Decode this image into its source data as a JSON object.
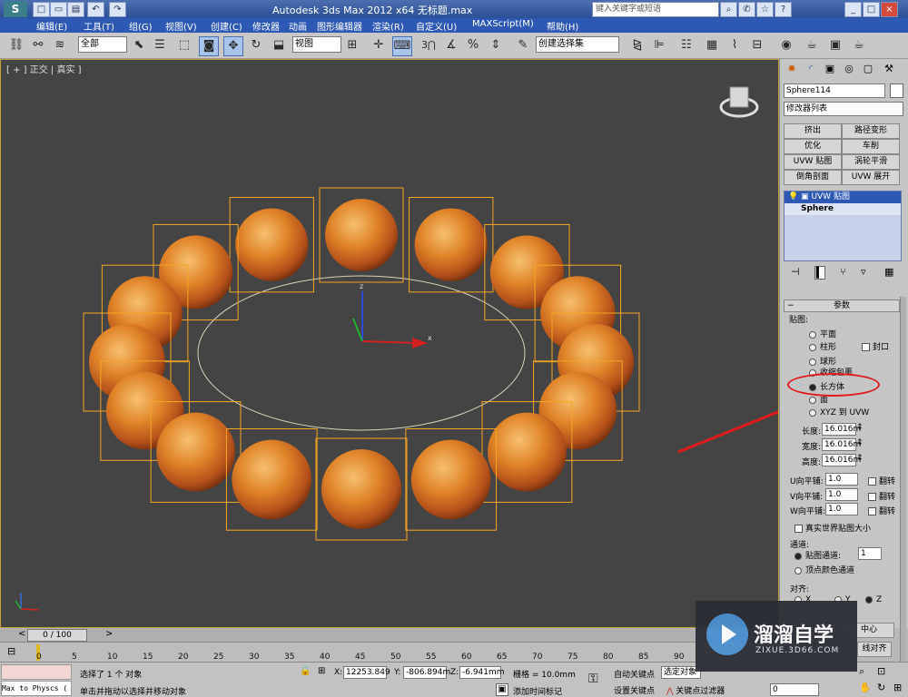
{
  "title_bar": {
    "title": "Autodesk 3ds Max  2012 x64    无标题.max",
    "search_placeholder": "键入关键字或短语"
  },
  "menu": {
    "items": [
      "编辑(E)",
      "工具(T)",
      "组(G)",
      "视图(V)",
      "创建(C)",
      "修改器",
      "动画",
      "图形编辑器",
      "渲染(R)",
      "自定义(U)",
      "MAXScript(M)",
      "帮助(H)"
    ]
  },
  "toolbar": {
    "selection_filter": "全部",
    "reference_coord": "视图",
    "named_selection": "创建选择集",
    "snap_label": "3"
  },
  "viewport": {
    "label": "[ + ] 正交 | 真实 ]",
    "axis_x": "x",
    "axis_y": "y",
    "axis_z": "z"
  },
  "command_panel": {
    "object_name": "Sphere114",
    "modifier_list": "修改器列表",
    "buttons": [
      "挤出",
      "路径变形",
      "优化",
      "车削",
      "UVW 贴图",
      "涡轮平滑",
      "倒角剖面",
      "UVW 展开"
    ],
    "stack_item": "UVW 贴图",
    "stack_base": "Sphere",
    "rollout_title": "参数",
    "mapping_group": "贴图:",
    "mapping_options": [
      "平面",
      "柱形",
      "球形",
      "收缩包裹",
      "长方体",
      "面",
      "XYZ 到 UVW"
    ],
    "cap_label": "封口",
    "selected_mapping": "长方体",
    "length_label": "长度:",
    "length_value": "16.016m",
    "width_label": "宽度:",
    "width_value": "16.016m",
    "height_label": "高度:",
    "height_value": "16.016m",
    "u_tile_label": "U向平铺:",
    "u_tile_value": "1.0",
    "v_tile_label": "V向平铺:",
    "v_tile_value": "1.0",
    "w_tile_label": "W向平铺:",
    "w_tile_value": "1.0",
    "flip_label": "翻转",
    "real_world_label": "真实世界贴图大小",
    "channel_group": "通道:",
    "map_channel_label": "贴图通道:",
    "map_channel_value": "1",
    "vertex_color_label": "顶点颜色通道",
    "align_group": "对齐:",
    "align_x": "X",
    "align_y": "Y",
    "align_z": "Z",
    "center_button": "中心",
    "fit_button": "线对齐"
  },
  "timeline": {
    "frame_display": "0 / 100",
    "ticks": [
      "0",
      "5",
      "10",
      "15",
      "20",
      "25",
      "30",
      "35",
      "40",
      "45",
      "50",
      "55",
      "60",
      "65",
      "70",
      "75",
      "80",
      "85",
      "90"
    ]
  },
  "status": {
    "script_listener": "Max to Physcs (",
    "selected_text": "选择了 1 个 对象",
    "prompt_text": "单击并拖动以选择并移动对象",
    "x_label": "X:",
    "x_value": "12253.849",
    "y_label": "Y:",
    "y_value": "-806.894m",
    "z_label": "Z:",
    "z_value": "-6.941mm",
    "grid_text": "栅格 = 10.0mm",
    "add_time_tag": "添加时间标记",
    "auto_key": "自动关键点",
    "set_key": "设置关键点",
    "selected_dropdown": "选定对象",
    "key_filters": "关键点过滤器",
    "current_frame": "0"
  },
  "watermark": {
    "brand": "溜溜自学",
    "url": "ZIXUE.3D66.COM"
  },
  "colors": {
    "accent_red": "#e01b1b",
    "wire_orange": "#f5a623",
    "viewport_bg": "#444444"
  }
}
